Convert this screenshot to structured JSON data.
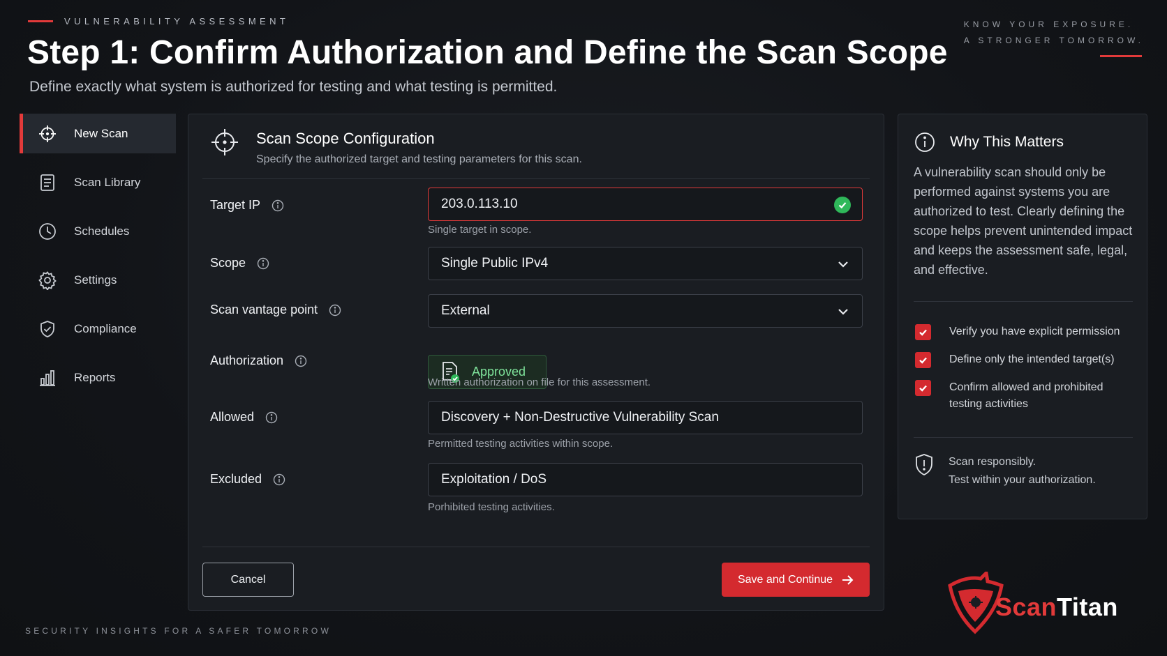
{
  "header": {
    "eyebrow": "VULNERABILITY ASSESSMENT",
    "title": "Step 1: Confirm Authorization and Define the Scan Scope",
    "subtitle": "Define exactly what system is authorized for testing and what testing is permitted.",
    "tagline_line1": "KNOW YOUR EXPOSURE.",
    "tagline_line2": "A STRONGER TOMORROW."
  },
  "sidebar": {
    "items": [
      {
        "label": "New Scan",
        "icon": "crosshair-icon",
        "active": true
      },
      {
        "label": "Scan Library",
        "icon": "document-icon",
        "active": false
      },
      {
        "label": "Schedules",
        "icon": "clock-icon",
        "active": false
      },
      {
        "label": "Settings",
        "icon": "gear-icon",
        "active": false
      },
      {
        "label": "Compliance",
        "icon": "shield-check-icon",
        "active": false
      },
      {
        "label": "Reports",
        "icon": "bar-chart-icon",
        "active": false
      }
    ]
  },
  "card": {
    "title": "Scan Scope Configuration",
    "subtitle": "Specify the authorized target and testing parameters for this scan.",
    "fields": {
      "target_ip": {
        "label": "Target IP",
        "value": "203.0.113.10",
        "helper": "Single target in scope."
      },
      "scope": {
        "label": "Scope",
        "value": "Single Public IPv4"
      },
      "vantage": {
        "label": "Scan vantage point",
        "value": "External"
      },
      "authorization": {
        "label": "Authorization",
        "value": "Approved",
        "helper": "Written authorization on file for this assessment."
      },
      "allowed": {
        "label": "Allowed",
        "value": "Discovery + Non-Destructive Vulnerability Scan",
        "helper": "Permitted testing activities within scope."
      },
      "excluded": {
        "label": "Excluded",
        "value": "Exploitation / DoS",
        "helper": "Porhibited testing activities."
      }
    },
    "cancel_label": "Cancel",
    "save_label": "Save and Continue"
  },
  "panel": {
    "title": "Why This Matters",
    "text": "A vulnerability scan should only be performed against systems you are authorized to test. Clearly defining the scope helps prevent unintended impact and keeps the assessment safe, legal, and effective.",
    "checklist": [
      "Verify you have explicit permission",
      "Define only the intended target(s)",
      "Confirm allowed and prohibited testing activities"
    ],
    "resp_line1": "Scan responsibly.",
    "resp_line2": "Test within your authorization."
  },
  "footer": {
    "text": "SECURITY INSIGHTS FOR A SAFER TOMORROW"
  },
  "logo": {
    "part1": "Scan",
    "part2": "Titan"
  },
  "colors": {
    "accent": "#e23a3a",
    "success": "#2fb85a",
    "background": "#121418",
    "card": "#1a1d22"
  }
}
